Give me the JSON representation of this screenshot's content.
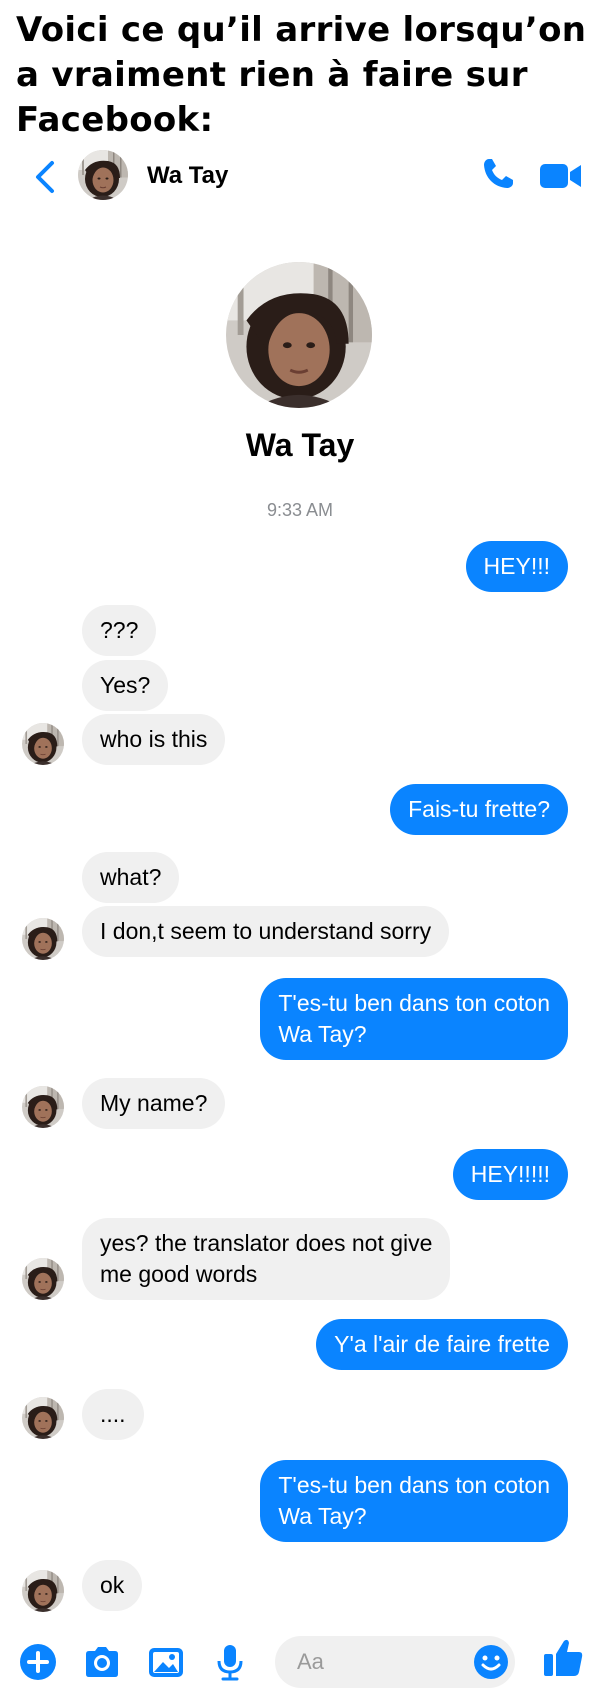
{
  "caption": {
    "line1": "Voici ce qu’il arrive lorsqu’on",
    "line2": "a vraiment rien à faire sur",
    "line3": "Facebook:"
  },
  "header": {
    "contact_name": "Wa Tay",
    "icons": [
      "back-chevron-icon",
      "phone-icon",
      "video-camera-icon"
    ]
  },
  "profile": {
    "name": "Wa Tay"
  },
  "timestamp": "9:33 AM",
  "messages": [
    {
      "side": "out",
      "text": "HEY!!!"
    },
    {
      "side": "in",
      "text": "???"
    },
    {
      "side": "in",
      "text": "Yes?"
    },
    {
      "side": "in",
      "text": "who is this"
    },
    {
      "side": "out",
      "text": "Fais-tu frette?"
    },
    {
      "side": "in",
      "text": "what?"
    },
    {
      "side": "in",
      "text": "I don,t seem to understand sorry"
    },
    {
      "side": "out",
      "line1": "T'es-tu ben dans ton coton",
      "line2": "Wa Tay?"
    },
    {
      "side": "in",
      "text": "My name?"
    },
    {
      "side": "out",
      "text": "HEY!!!!!"
    },
    {
      "side": "in",
      "line1": "yes? the translator does not give",
      "line2": "me good words"
    },
    {
      "side": "out",
      "text": "Y'a l'air de faire frette"
    },
    {
      "side": "in",
      "text": "...."
    },
    {
      "side": "out",
      "line1": "T'es-tu ben dans ton coton",
      "line2": "Wa Tay?"
    },
    {
      "side": "in",
      "text": "ok"
    }
  ],
  "composer": {
    "placeholder": "Aa",
    "icons": [
      "plus-icon",
      "camera-icon",
      "image-icon",
      "microphone-icon",
      "emoji-icon",
      "thumbs-up-icon"
    ]
  },
  "colors": {
    "accent": "#0a84ff",
    "incoming_bubble": "#f0f0f0",
    "timestamp": "#8a8d91"
  }
}
